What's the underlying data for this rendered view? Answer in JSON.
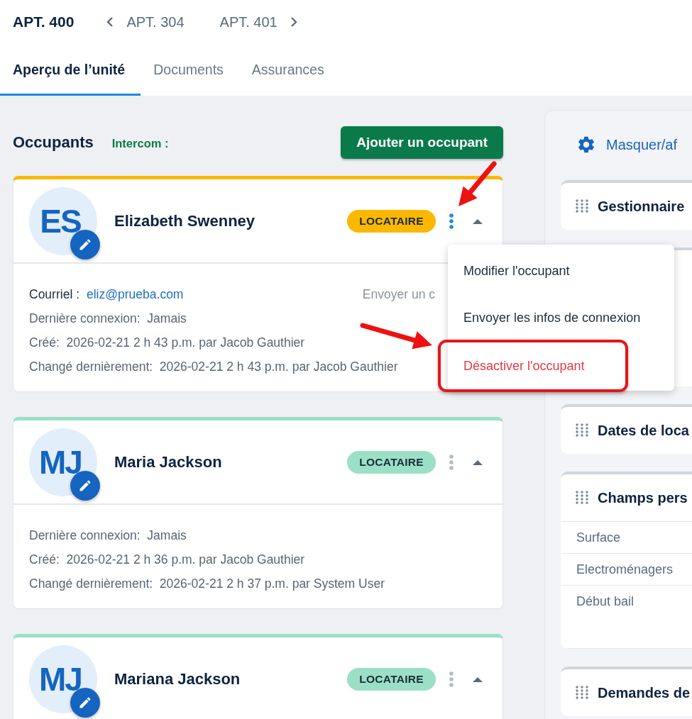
{
  "unit_nav": {
    "current": "APT. 400",
    "previous": "APT. 304",
    "next": "APT. 401"
  },
  "tabs": [
    {
      "label": "Aperçu de l’unité",
      "selected": true
    },
    {
      "label": "Documents",
      "selected": false
    },
    {
      "label": "Assurances",
      "selected": false
    }
  ],
  "occupants_section": {
    "title": "Occupants",
    "intercom_label": "Intercom :",
    "add_button": "Ajouter un occupant"
  },
  "occupants": [
    {
      "initials": "ES",
      "name": "Elizabeth Swenney",
      "role": "LOCATAIRE",
      "color": "#fbb800",
      "menu_open": true,
      "arrow_pointer": true,
      "email_label": "Courriel :",
      "email": "eliz@prueba.com",
      "send_link": "Envoyer un c",
      "details": [
        "Dernière connexion:  Jamais",
        "Créé:  2026-02-21 2 h 43 p.m. par Jacob Gauthier",
        "Changé dernièrement:  2026-02-21 2 h 43 p.m. par Jacob Gauthier"
      ],
      "menu": [
        {
          "label": "Modifier l'occupant",
          "danger": false,
          "highlighted": false
        },
        {
          "label": "Envoyer les infos de connexion",
          "danger": false,
          "highlighted": false
        },
        {
          "label": "Désactiver l'occupant",
          "danger": true,
          "highlighted": true
        }
      ]
    },
    {
      "initials": "MJ",
      "name": "Maria Jackson",
      "role": "LOCATAIRE",
      "color": "#9be0c6",
      "menu_open": false,
      "arrow_pointer": false,
      "details": [
        "Dernière connexion:  Jamais",
        "Créé:  2026-02-21 2 h 36 p.m. par Jacob Gauthier",
        "Changé dernièrement:  2026-02-21 2 h 37 p.m. par System User"
      ]
    },
    {
      "initials": "MJ",
      "name": "Mariana Jackson",
      "role": "LOCATAIRE",
      "color": "#9be0c6",
      "menu_open": false,
      "arrow_pointer": false
    }
  ],
  "side_panel": {
    "toggle_link": "Masquer/af",
    "cards": [
      {
        "kind": "card",
        "title": "Gestionnaire"
      },
      {
        "kind": "covered"
      },
      {
        "kind": "card",
        "title": "Dates de loca"
      },
      {
        "kind": "card",
        "title": "Champs pers",
        "rows": [
          "Surface",
          "Electroménagers",
          "Début bail"
        ]
      },
      {
        "kind": "card",
        "title": "Demandes de"
      }
    ]
  }
}
